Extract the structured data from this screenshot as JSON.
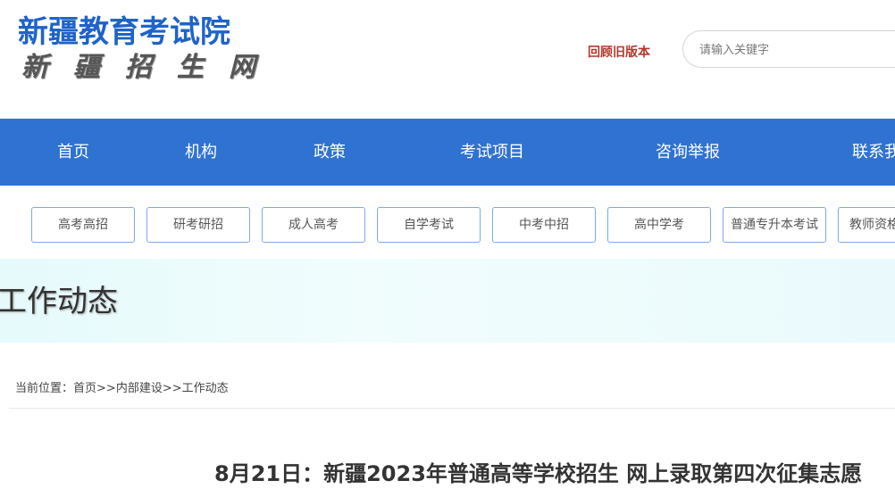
{
  "header": {
    "logo_main": "新疆教育考试院",
    "logo_sub": "新疆招生网",
    "old_version": "回顾旧版本",
    "search_placeholder": "请输入关键字"
  },
  "nav": {
    "items": [
      "首页",
      "机构",
      "政策",
      "考试项目",
      "咨询举报",
      "联系我"
    ]
  },
  "subnav": {
    "items": [
      "高考高招",
      "研考研招",
      "成人高考",
      "自学考试",
      "中考中招",
      "高中学考",
      "普通专升本考试",
      "教师资格"
    ]
  },
  "banner": {
    "title": "工作动态"
  },
  "breadcrumb": {
    "prefix": "当前位置：",
    "home": "首页",
    "sep1": ">>",
    "section": "内部建设",
    "sep2": ">>",
    "current": "工作动态"
  },
  "article": {
    "title": "8月21日：新疆2023年普通高等学校招生 网上录取第四次征集志愿"
  }
}
